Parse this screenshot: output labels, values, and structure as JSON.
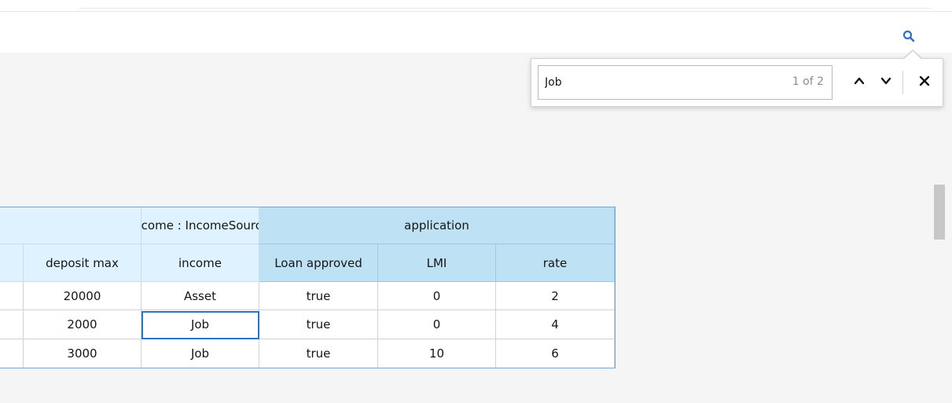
{
  "search": {
    "value": "Job",
    "match_count": "1 of 2",
    "icons": {
      "toggle": "search-icon",
      "prev": "chevron-up-icon",
      "next": "chevron-down-icon",
      "close": "close-icon"
    }
  },
  "table": {
    "group_headers": {
      "income_group": "income : IncomeSource",
      "application_group": "application"
    },
    "columns": [
      "deposit max",
      "income",
      "Loan approved",
      "LMI",
      "rate"
    ],
    "rows": [
      [
        "20000",
        "Asset",
        "true",
        "0",
        "2"
      ],
      [
        "2000",
        "Job",
        "true",
        "0",
        "4"
      ],
      [
        "3000",
        "Job",
        "true",
        "10",
        "6"
      ]
    ]
  },
  "colors": {
    "accent": "#2b74bf",
    "header_light": "#def3ff",
    "header_dark": "#bee1f4"
  }
}
